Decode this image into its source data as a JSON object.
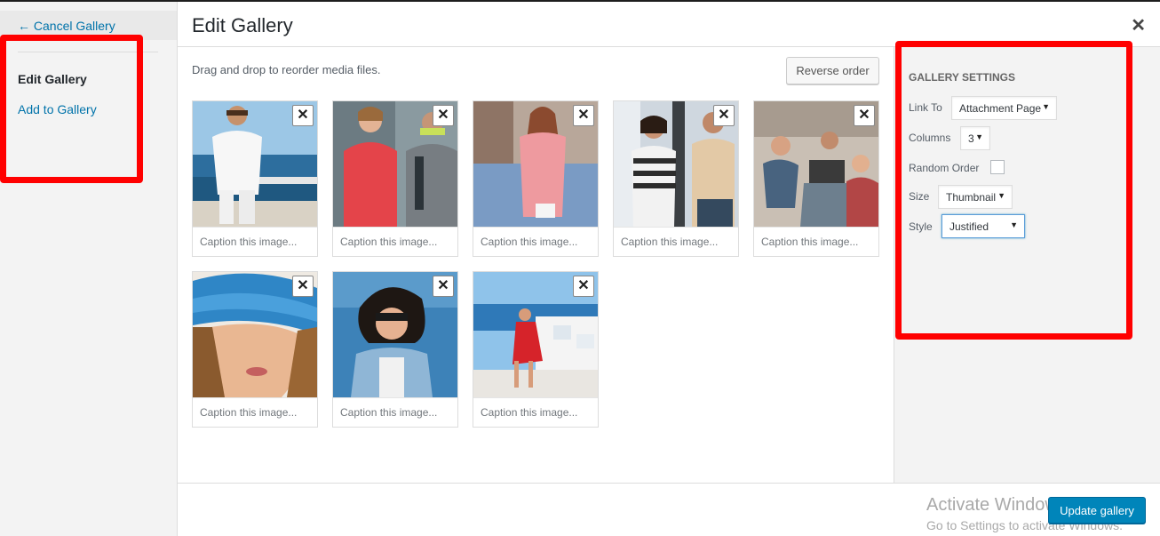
{
  "menu": {
    "cancel_label": "← Cancel Gallery",
    "items": [
      {
        "label": "Edit Gallery"
      },
      {
        "label": "Add to Gallery"
      }
    ]
  },
  "frame": {
    "title": "Edit Gallery",
    "close_icon": "close-icon"
  },
  "content": {
    "instructions": "Drag and drop to reorder media files.",
    "reverse_label": "Reverse order",
    "caption_placeholder": "Caption this image...",
    "tile_count": 8,
    "remove_icon": "remove-icon"
  },
  "settings": {
    "title": "Gallery Settings",
    "link_to_label": "Link To",
    "link_to_value": "Attachment Page",
    "columns_label": "Columns",
    "columns_value": "3",
    "random_label": "Random Order",
    "random_checked": false,
    "size_label": "Size",
    "size_value": "Thumbnail",
    "style_label": "Style",
    "style_value": "Justified"
  },
  "toolbar": {
    "update_label": "Update gallery"
  },
  "watermark": {
    "line1": "Activate Windows",
    "line2": "Go to Settings to activate Windows."
  },
  "colors": {
    "accent": "#0085ba",
    "link": "#0073aa",
    "annotation": "#ff0000"
  }
}
